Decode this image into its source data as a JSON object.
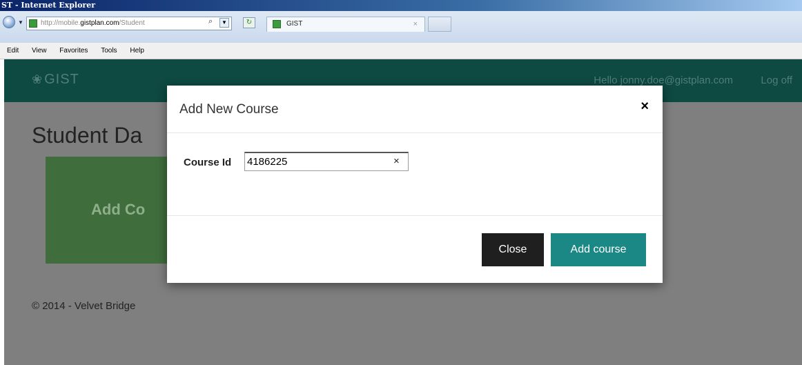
{
  "window": {
    "title": "ST - Internet Explorer"
  },
  "browser": {
    "address": {
      "prefix": "http://mobile.",
      "host": "gistplan.com",
      "path": "/Student",
      "search_icon": "⌕"
    },
    "tab": {
      "label": "GIST",
      "close": "×"
    },
    "menu": [
      "Edit",
      "View",
      "Favorites",
      "Tools",
      "Help"
    ]
  },
  "site": {
    "brand": "GIST",
    "brand_icon": "❀",
    "greeting": "Hello jonny.doe@gistplan.com",
    "logoff": "Log off",
    "page_title": "Student Da",
    "tile_label": "Add Co",
    "tile_color": "#3f6e3c",
    "navbar_color": "#0e4942",
    "footer": "© 2014 - Velvet Bridge"
  },
  "modal": {
    "title": "Add New Course",
    "close_icon": "×",
    "field_label": "Course Id",
    "field_value": "4186225",
    "field_clear": "×",
    "close_button": "Close",
    "add_button": "Add course",
    "add_button_color": "#1b8886"
  }
}
